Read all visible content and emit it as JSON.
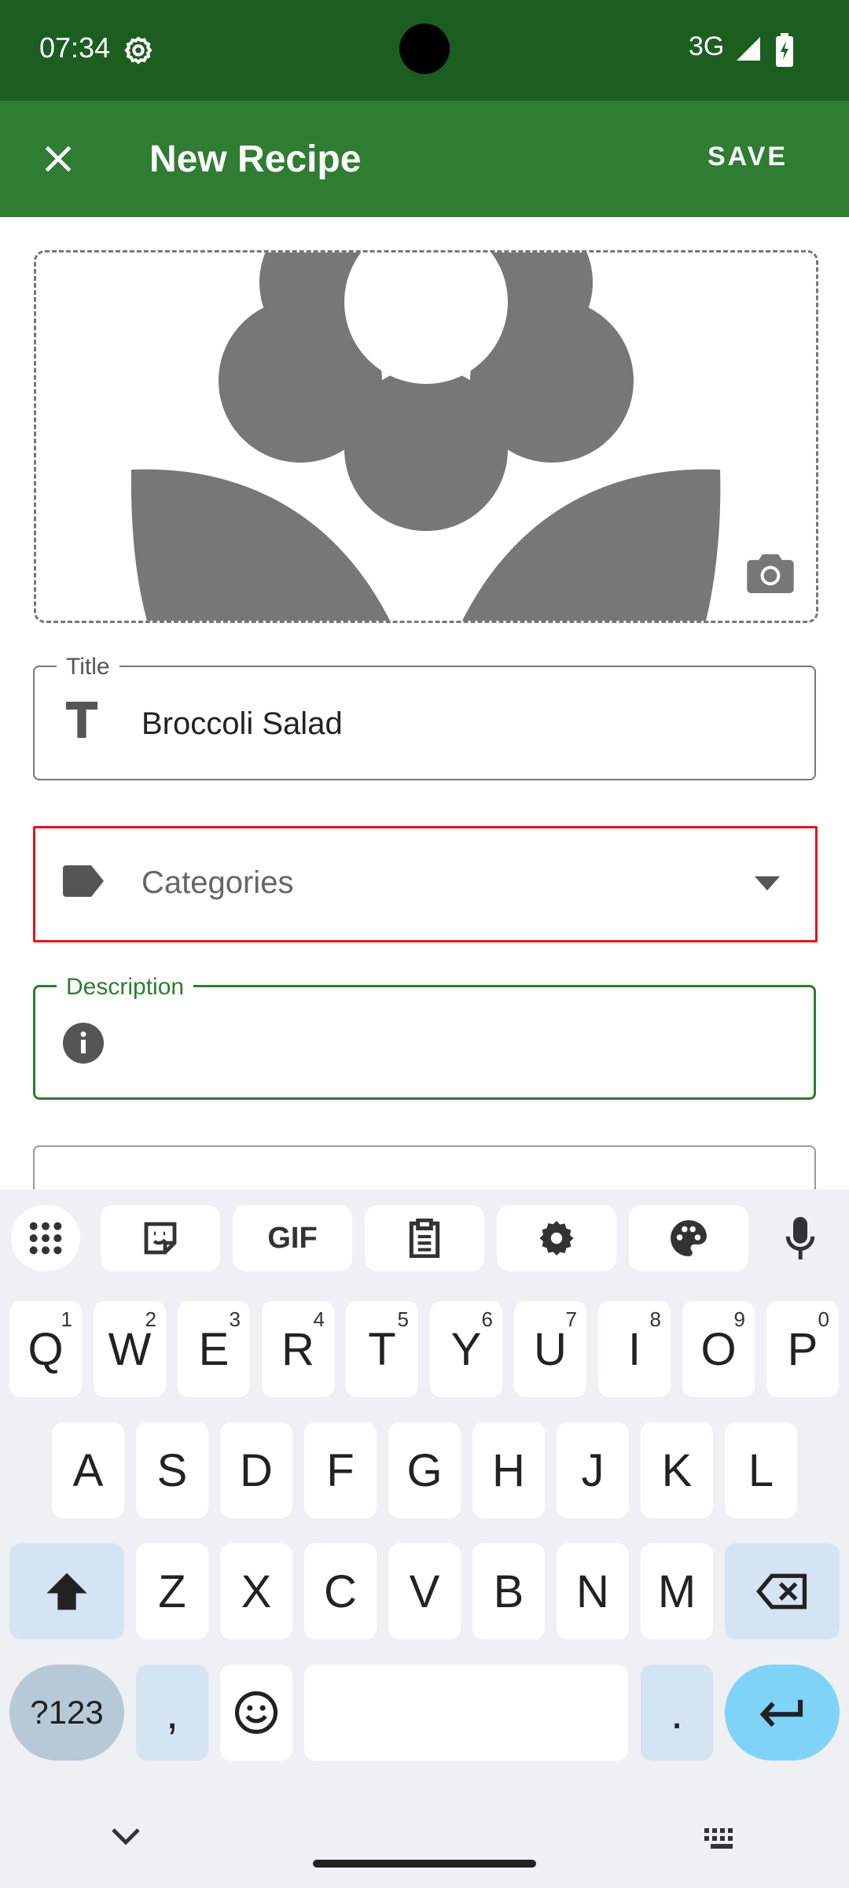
{
  "status_bar": {
    "time": "07:34",
    "network": "3G"
  },
  "app_bar": {
    "title": "New Recipe",
    "save_label": "SAVE"
  },
  "form": {
    "title_legend": "Title",
    "title_value": "Broccoli Salad",
    "categories_placeholder": "Categories",
    "description_legend": "Description",
    "description_value": ""
  },
  "keyboard": {
    "toolbar": [
      "apps-grid-icon",
      "sticker-icon",
      "GIF",
      "clipboard-icon",
      "settings-icon",
      "palette-icon",
      "mic-icon"
    ],
    "row1": [
      {
        "key": "Q",
        "hint": "1"
      },
      {
        "key": "W",
        "hint": "2"
      },
      {
        "key": "E",
        "hint": "3"
      },
      {
        "key": "R",
        "hint": "4"
      },
      {
        "key": "T",
        "hint": "5"
      },
      {
        "key": "Y",
        "hint": "6"
      },
      {
        "key": "U",
        "hint": "7"
      },
      {
        "key": "I",
        "hint": "8"
      },
      {
        "key": "O",
        "hint": "9"
      },
      {
        "key": "P",
        "hint": "0"
      }
    ],
    "row2": [
      "A",
      "S",
      "D",
      "F",
      "G",
      "H",
      "J",
      "K",
      "L"
    ],
    "row3": [
      "Z",
      "X",
      "C",
      "V",
      "B",
      "N",
      "M"
    ],
    "symbols_label": "?123",
    "comma": ",",
    "period": "."
  },
  "colors": {
    "status_bar": "#1b5e20",
    "app_bar": "#2e7d32",
    "focus_border": "#2e7d32",
    "highlight": "#ee1111"
  }
}
